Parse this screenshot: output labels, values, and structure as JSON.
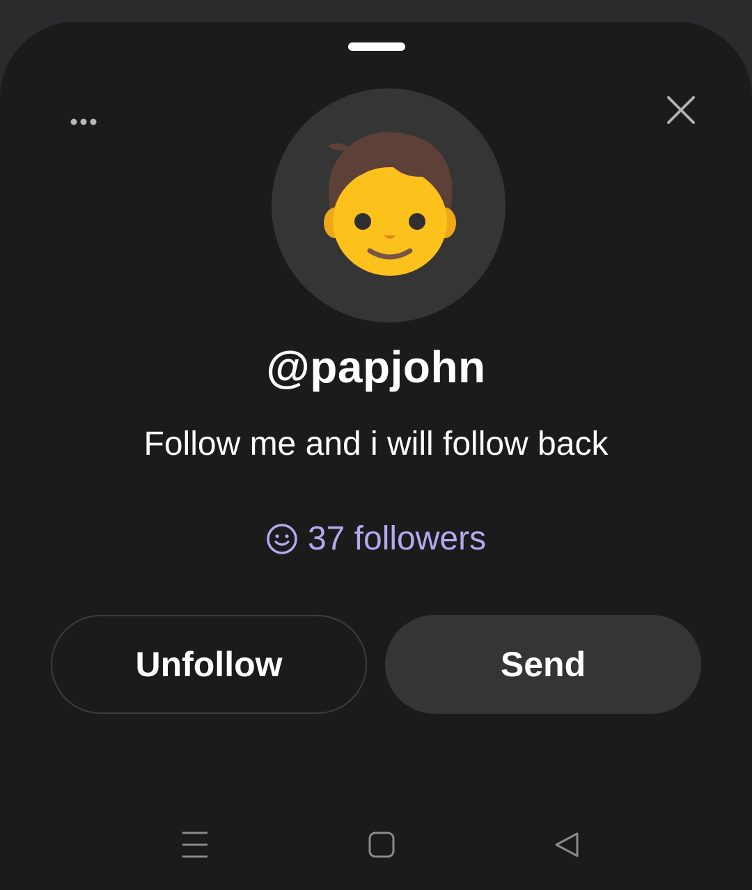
{
  "profile": {
    "username": "@papjohn",
    "bio": "Follow me and i will follow back",
    "followers_label": "37 followers",
    "avatar_emoji": "🧒"
  },
  "actions": {
    "unfollow_label": "Unfollow",
    "send_label": "Send"
  },
  "icons": {
    "more": "more-horizontal-icon",
    "close": "close-icon",
    "followers": "smiley-icon",
    "nav_recents": "menu-lines-icon",
    "nav_home": "square-icon",
    "nav_back": "triangle-back-icon"
  },
  "colors": {
    "background": "#1b1b1b",
    "surface": "#353535",
    "accent": "#b3a9f0",
    "text": "#ffffff"
  }
}
